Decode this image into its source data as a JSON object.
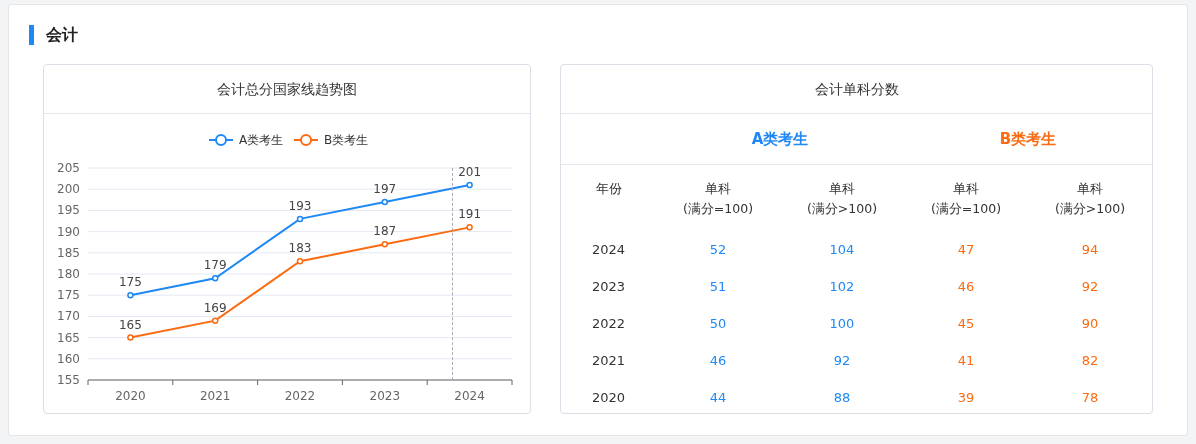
{
  "section": {
    "title": "会计"
  },
  "trend_panel": {
    "title": "会计总分国家线趋势图",
    "chart_data": {
      "type": "line",
      "categories": [
        "2020",
        "2021",
        "2022",
        "2023",
        "2024"
      ],
      "series": [
        {
          "name": "A类考生",
          "color": "#1e88f5",
          "marker": "circle",
          "values": [
            175,
            179,
            193,
            197,
            201
          ]
        },
        {
          "name": "B类考生",
          "color": "#fa6b12",
          "marker": "circle",
          "values": [
            165,
            169,
            183,
            187,
            191
          ]
        }
      ],
      "ylim": [
        155,
        205
      ],
      "yticks": [
        155,
        160,
        165,
        170,
        175,
        180,
        185,
        190,
        195,
        200,
        205
      ],
      "data_labels": true,
      "grid": true,
      "legend": true
    }
  },
  "score_panel": {
    "title": "会计单科分数",
    "year_column": "年份",
    "groups": [
      {
        "label": "A类考生",
        "color": "#1e88f5",
        "columns": [
          {
            "label": "单科",
            "sub": "(满分=100)"
          },
          {
            "label": "单科",
            "sub": "(满分>100)"
          }
        ]
      },
      {
        "label": "B类考生",
        "color": "#fa6b12",
        "columns": [
          {
            "label": "单科",
            "sub": "(满分=100)"
          },
          {
            "label": "单科",
            "sub": "(满分>100)"
          }
        ]
      }
    ],
    "rows": [
      {
        "year": "2024",
        "scores": [
          "52",
          "104",
          "47",
          "94"
        ]
      },
      {
        "year": "2023",
        "scores": [
          "51",
          "102",
          "46",
          "92"
        ]
      },
      {
        "year": "2022",
        "scores": [
          "50",
          "100",
          "45",
          "90"
        ]
      },
      {
        "year": "2021",
        "scores": [
          "46",
          "92",
          "41",
          "82"
        ]
      },
      {
        "year": "2020",
        "scores": [
          "44",
          "88",
          "39",
          "78"
        ]
      }
    ]
  }
}
